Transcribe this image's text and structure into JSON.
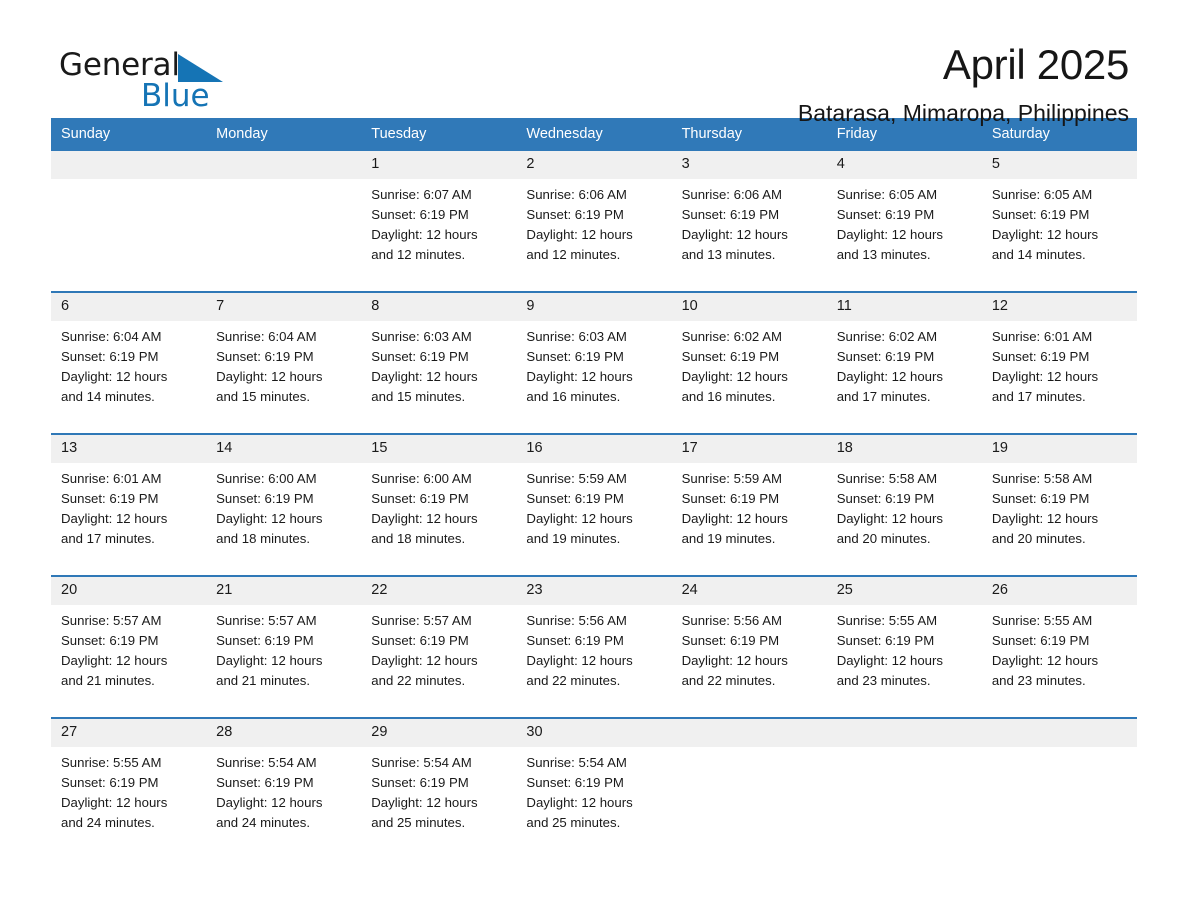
{
  "brand": {
    "name_part1": "General",
    "name_part2": "Blue",
    "triangle_color": "#1574b5"
  },
  "header": {
    "month_title": "April 2025",
    "location": "Batarasa, Mimaropa, Philippines"
  },
  "calendar": {
    "header_bg": "#3079b8",
    "daynum_bg": "#f0f0f0",
    "separator_color": "#2f78b7",
    "weekday_headers": [
      "Sunday",
      "Monday",
      "Tuesday",
      "Wednesday",
      "Thursday",
      "Friday",
      "Saturday"
    ],
    "weeks": [
      [
        {
          "day": "",
          "sunrise": "",
          "sunset": "",
          "daylight_line1": "",
          "daylight_line2": ""
        },
        {
          "day": "",
          "sunrise": "",
          "sunset": "",
          "daylight_line1": "",
          "daylight_line2": ""
        },
        {
          "day": "1",
          "sunrise": "Sunrise: 6:07 AM",
          "sunset": "Sunset: 6:19 PM",
          "daylight_line1": "Daylight: 12 hours",
          "daylight_line2": "and 12 minutes."
        },
        {
          "day": "2",
          "sunrise": "Sunrise: 6:06 AM",
          "sunset": "Sunset: 6:19 PM",
          "daylight_line1": "Daylight: 12 hours",
          "daylight_line2": "and 12 minutes."
        },
        {
          "day": "3",
          "sunrise": "Sunrise: 6:06 AM",
          "sunset": "Sunset: 6:19 PM",
          "daylight_line1": "Daylight: 12 hours",
          "daylight_line2": "and 13 minutes."
        },
        {
          "day": "4",
          "sunrise": "Sunrise: 6:05 AM",
          "sunset": "Sunset: 6:19 PM",
          "daylight_line1": "Daylight: 12 hours",
          "daylight_line2": "and 13 minutes."
        },
        {
          "day": "5",
          "sunrise": "Sunrise: 6:05 AM",
          "sunset": "Sunset: 6:19 PM",
          "daylight_line1": "Daylight: 12 hours",
          "daylight_line2": "and 14 minutes."
        }
      ],
      [
        {
          "day": "6",
          "sunrise": "Sunrise: 6:04 AM",
          "sunset": "Sunset: 6:19 PM",
          "daylight_line1": "Daylight: 12 hours",
          "daylight_line2": "and 14 minutes."
        },
        {
          "day": "7",
          "sunrise": "Sunrise: 6:04 AM",
          "sunset": "Sunset: 6:19 PM",
          "daylight_line1": "Daylight: 12 hours",
          "daylight_line2": "and 15 minutes."
        },
        {
          "day": "8",
          "sunrise": "Sunrise: 6:03 AM",
          "sunset": "Sunset: 6:19 PM",
          "daylight_line1": "Daylight: 12 hours",
          "daylight_line2": "and 15 minutes."
        },
        {
          "day": "9",
          "sunrise": "Sunrise: 6:03 AM",
          "sunset": "Sunset: 6:19 PM",
          "daylight_line1": "Daylight: 12 hours",
          "daylight_line2": "and 16 minutes."
        },
        {
          "day": "10",
          "sunrise": "Sunrise: 6:02 AM",
          "sunset": "Sunset: 6:19 PM",
          "daylight_line1": "Daylight: 12 hours",
          "daylight_line2": "and 16 minutes."
        },
        {
          "day": "11",
          "sunrise": "Sunrise: 6:02 AM",
          "sunset": "Sunset: 6:19 PM",
          "daylight_line1": "Daylight: 12 hours",
          "daylight_line2": "and 17 minutes."
        },
        {
          "day": "12",
          "sunrise": "Sunrise: 6:01 AM",
          "sunset": "Sunset: 6:19 PM",
          "daylight_line1": "Daylight: 12 hours",
          "daylight_line2": "and 17 minutes."
        }
      ],
      [
        {
          "day": "13",
          "sunrise": "Sunrise: 6:01 AM",
          "sunset": "Sunset: 6:19 PM",
          "daylight_line1": "Daylight: 12 hours",
          "daylight_line2": "and 17 minutes."
        },
        {
          "day": "14",
          "sunrise": "Sunrise: 6:00 AM",
          "sunset": "Sunset: 6:19 PM",
          "daylight_line1": "Daylight: 12 hours",
          "daylight_line2": "and 18 minutes."
        },
        {
          "day": "15",
          "sunrise": "Sunrise: 6:00 AM",
          "sunset": "Sunset: 6:19 PM",
          "daylight_line1": "Daylight: 12 hours",
          "daylight_line2": "and 18 minutes."
        },
        {
          "day": "16",
          "sunrise": "Sunrise: 5:59 AM",
          "sunset": "Sunset: 6:19 PM",
          "daylight_line1": "Daylight: 12 hours",
          "daylight_line2": "and 19 minutes."
        },
        {
          "day": "17",
          "sunrise": "Sunrise: 5:59 AM",
          "sunset": "Sunset: 6:19 PM",
          "daylight_line1": "Daylight: 12 hours",
          "daylight_line2": "and 19 minutes."
        },
        {
          "day": "18",
          "sunrise": "Sunrise: 5:58 AM",
          "sunset": "Sunset: 6:19 PM",
          "daylight_line1": "Daylight: 12 hours",
          "daylight_line2": "and 20 minutes."
        },
        {
          "day": "19",
          "sunrise": "Sunrise: 5:58 AM",
          "sunset": "Sunset: 6:19 PM",
          "daylight_line1": "Daylight: 12 hours",
          "daylight_line2": "and 20 minutes."
        }
      ],
      [
        {
          "day": "20",
          "sunrise": "Sunrise: 5:57 AM",
          "sunset": "Sunset: 6:19 PM",
          "daylight_line1": "Daylight: 12 hours",
          "daylight_line2": "and 21 minutes."
        },
        {
          "day": "21",
          "sunrise": "Sunrise: 5:57 AM",
          "sunset": "Sunset: 6:19 PM",
          "daylight_line1": "Daylight: 12 hours",
          "daylight_line2": "and 21 minutes."
        },
        {
          "day": "22",
          "sunrise": "Sunrise: 5:57 AM",
          "sunset": "Sunset: 6:19 PM",
          "daylight_line1": "Daylight: 12 hours",
          "daylight_line2": "and 22 minutes."
        },
        {
          "day": "23",
          "sunrise": "Sunrise: 5:56 AM",
          "sunset": "Sunset: 6:19 PM",
          "daylight_line1": "Daylight: 12 hours",
          "daylight_line2": "and 22 minutes."
        },
        {
          "day": "24",
          "sunrise": "Sunrise: 5:56 AM",
          "sunset": "Sunset: 6:19 PM",
          "daylight_line1": "Daylight: 12 hours",
          "daylight_line2": "and 22 minutes."
        },
        {
          "day": "25",
          "sunrise": "Sunrise: 5:55 AM",
          "sunset": "Sunset: 6:19 PM",
          "daylight_line1": "Daylight: 12 hours",
          "daylight_line2": "and 23 minutes."
        },
        {
          "day": "26",
          "sunrise": "Sunrise: 5:55 AM",
          "sunset": "Sunset: 6:19 PM",
          "daylight_line1": "Daylight: 12 hours",
          "daylight_line2": "and 23 minutes."
        }
      ],
      [
        {
          "day": "27",
          "sunrise": "Sunrise: 5:55 AM",
          "sunset": "Sunset: 6:19 PM",
          "daylight_line1": "Daylight: 12 hours",
          "daylight_line2": "and 24 minutes."
        },
        {
          "day": "28",
          "sunrise": "Sunrise: 5:54 AM",
          "sunset": "Sunset: 6:19 PM",
          "daylight_line1": "Daylight: 12 hours",
          "daylight_line2": "and 24 minutes."
        },
        {
          "day": "29",
          "sunrise": "Sunrise: 5:54 AM",
          "sunset": "Sunset: 6:19 PM",
          "daylight_line1": "Daylight: 12 hours",
          "daylight_line2": "and 25 minutes."
        },
        {
          "day": "30",
          "sunrise": "Sunrise: 5:54 AM",
          "sunset": "Sunset: 6:19 PM",
          "daylight_line1": "Daylight: 12 hours",
          "daylight_line2": "and 25 minutes."
        },
        {
          "day": "",
          "sunrise": "",
          "sunset": "",
          "daylight_line1": "",
          "daylight_line2": ""
        },
        {
          "day": "",
          "sunrise": "",
          "sunset": "",
          "daylight_line1": "",
          "daylight_line2": ""
        },
        {
          "day": "",
          "sunrise": "",
          "sunset": "",
          "daylight_line1": "",
          "daylight_line2": ""
        }
      ]
    ]
  }
}
